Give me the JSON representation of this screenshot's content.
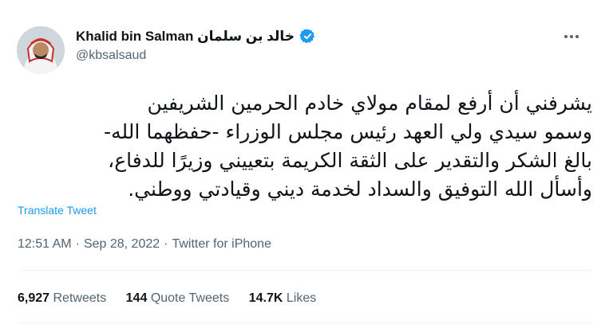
{
  "author": {
    "display_name": "Khalid bin Salman خالد بن سلمان",
    "handle": "@kbsalsaud",
    "verified": true
  },
  "tweet": {
    "lines": [
      "يشرفني أن أرفع لمقام مولاي خادم الحرمين الشريفين",
      "وسمو سيدي ولي العهد رئيس مجلس الوزراء -حفظهما الله-",
      "بالغ الشكر والتقدير على الثقة الكريمة بتعييني وزيرًا للدفاع،",
      "وأسأل الله التوفيق والسداد لخدمة ديني وقيادتي ووطني."
    ],
    "translate_label": "Translate Tweet",
    "time": "12:51 AM",
    "separator": "·",
    "date": "Sep 28, 2022",
    "source": "Twitter for iPhone"
  },
  "stats": {
    "retweets_count": "6,927",
    "retweets_label": "Retweets",
    "quotes_count": "144",
    "quotes_label": "Quote Tweets",
    "likes_count": "14.7K",
    "likes_label": "Likes"
  },
  "icons": {
    "more": "more-options-icon",
    "verified": "verified-badge-icon"
  },
  "colors": {
    "link": "#1d9bf0",
    "secondary_text": "#536471",
    "primary_text": "#0f1419"
  }
}
